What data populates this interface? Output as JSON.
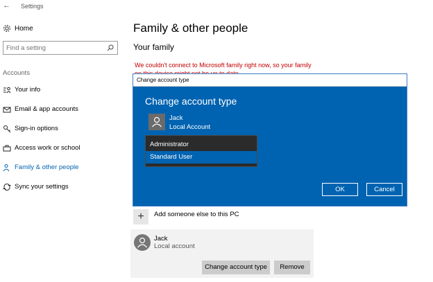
{
  "window": {
    "title": "Settings",
    "back_glyph": "←"
  },
  "sidebar": {
    "home_label": "Home",
    "search_placeholder": "Find a setting",
    "section_label": "Accounts",
    "items": [
      {
        "label": "Your info",
        "icon": "user-info-icon",
        "active": false
      },
      {
        "label": "Email & app accounts",
        "icon": "mail-icon",
        "active": false
      },
      {
        "label": "Sign-in options",
        "icon": "key-icon",
        "active": false
      },
      {
        "label": "Access work or school",
        "icon": "briefcase-icon",
        "active": false
      },
      {
        "label": "Family & other people",
        "icon": "people-icon",
        "active": true
      },
      {
        "label": "Sync your settings",
        "icon": "sync-icon",
        "active": false
      }
    ]
  },
  "main": {
    "title": "Family & other people",
    "section_title": "Your family",
    "error_text": "We couldn't connect to Microsoft family right now, so your family on this device might not be up to date.",
    "add_label": "Add someone else to this PC",
    "account": {
      "name": "Jack",
      "type": "Local account",
      "change_button": "Change account type",
      "remove_button": "Remove"
    }
  },
  "dialog": {
    "window_title": "Change account type",
    "heading": "Change account type",
    "user_name": "Jack",
    "user_type": "Local Account",
    "options": [
      "Administrator",
      "Standard User"
    ],
    "selected_option": "Standard User",
    "ok_label": "OK",
    "cancel_label": "Cancel"
  },
  "colors": {
    "accent": "#0063b1",
    "error": "#c00000",
    "dropdown_bg": "#2b2b2b"
  }
}
